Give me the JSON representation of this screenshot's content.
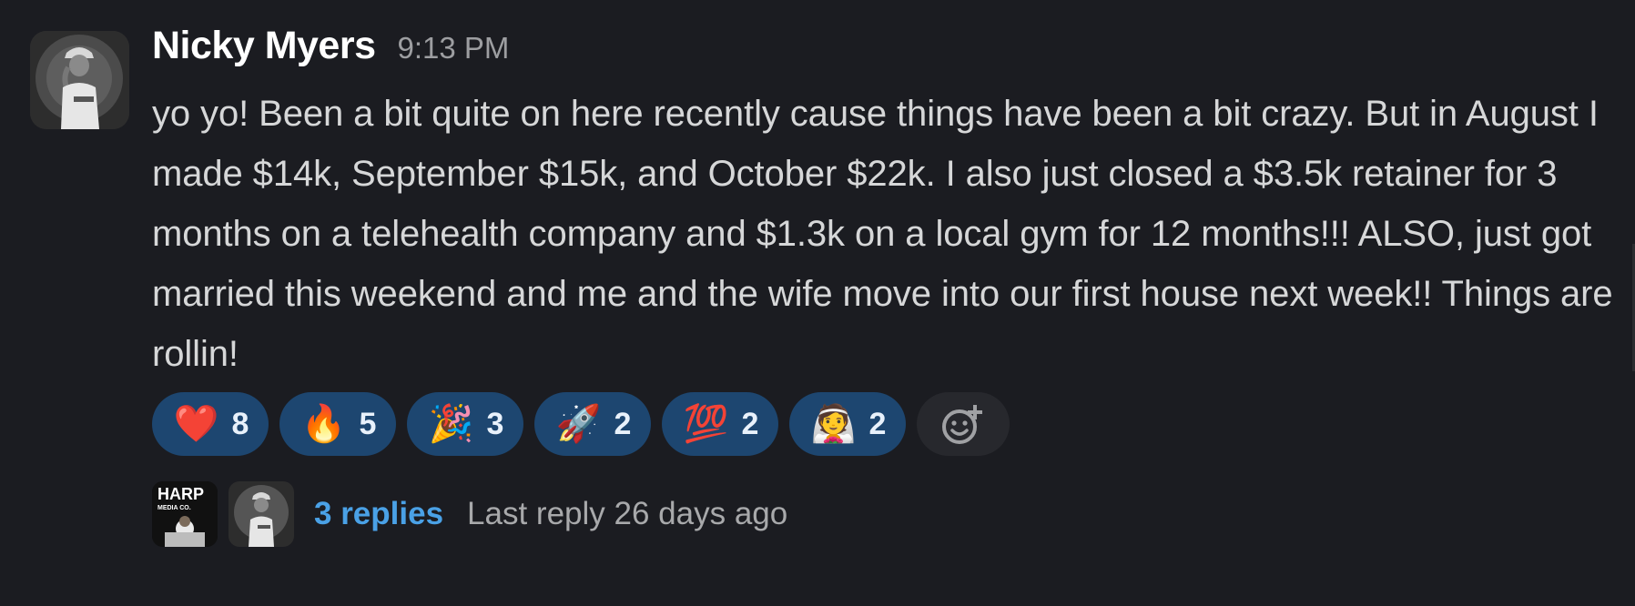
{
  "message": {
    "author": "Nicky Myers",
    "timestamp": "9:13 PM",
    "text": "yo yo! Been a bit quite on here recently cause things have been a bit crazy. But in August I made $14k, September $15k, and October $22k. I also just closed a $3.5k retainer for 3 months on a telehealth company and $1.3k on a local gym for 12 months!!! ALSO, just got married this weekend and me and the wife move into our first house next week!! Things are rollin!"
  },
  "reactions": [
    {
      "emoji": "❤️",
      "icon": "red-heart-icon",
      "count": "8"
    },
    {
      "emoji": "🔥",
      "icon": "fire-icon",
      "count": "5"
    },
    {
      "emoji": "🎉",
      "icon": "party-popper-icon",
      "count": "3"
    },
    {
      "emoji": "🚀",
      "icon": "rocket-icon",
      "count": "2"
    },
    {
      "emoji": "💯",
      "icon": "hundred-points-icon",
      "count": "2"
    },
    {
      "emoji": "👰",
      "icon": "bride-icon",
      "count": "2"
    }
  ],
  "add_reaction_icon": "add-reaction-icon",
  "thread": {
    "participant_1_logo": {
      "line1": "HARP",
      "line2": "MEDIA CO."
    },
    "replies": "3 replies",
    "last_reply": "Last reply 26 days ago"
  },
  "colors": {
    "background": "#1b1c21",
    "reaction_bg": "#1d4670",
    "link": "#4aa1e6"
  }
}
